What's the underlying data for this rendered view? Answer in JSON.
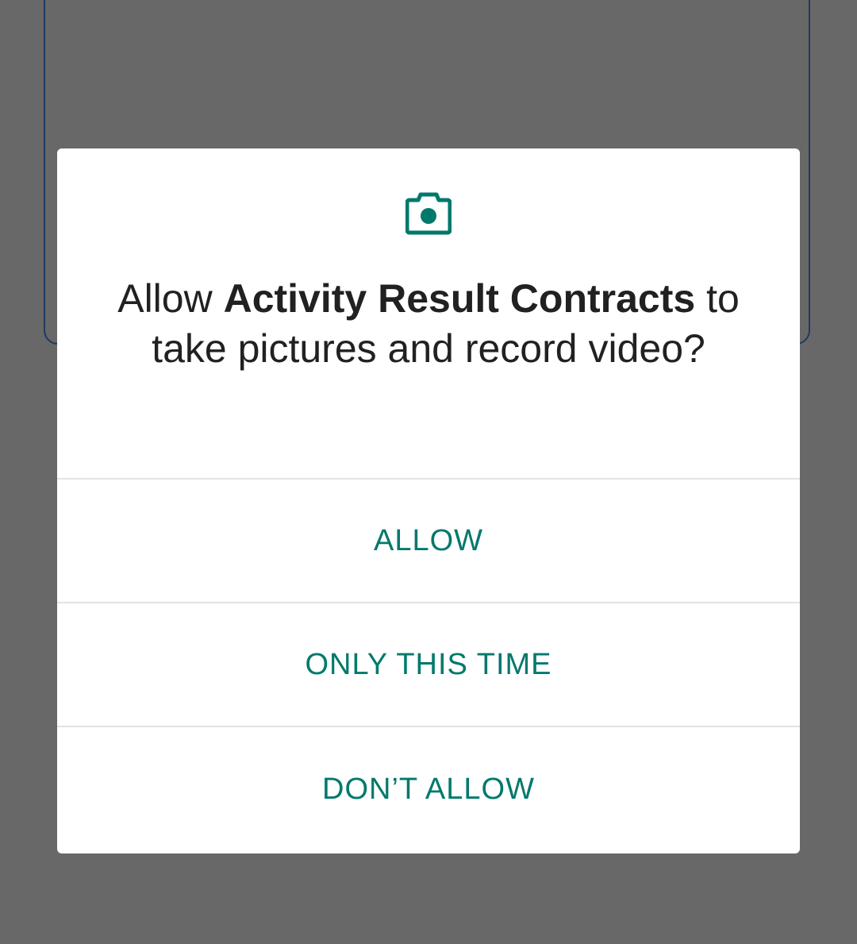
{
  "dialog": {
    "icon": "camera-icon",
    "prompt_prefix": "Allow ",
    "app_name": "Activity Result Contracts",
    "prompt_suffix": " to take pictures and record video?",
    "buttons": {
      "allow": "ALLOW",
      "only_this_time": "ONLY THIS TIME",
      "dont_allow": "DON’T ALLOW"
    }
  },
  "colors": {
    "accent": "#00796b",
    "scrim": "#686868",
    "text": "#212121"
  }
}
